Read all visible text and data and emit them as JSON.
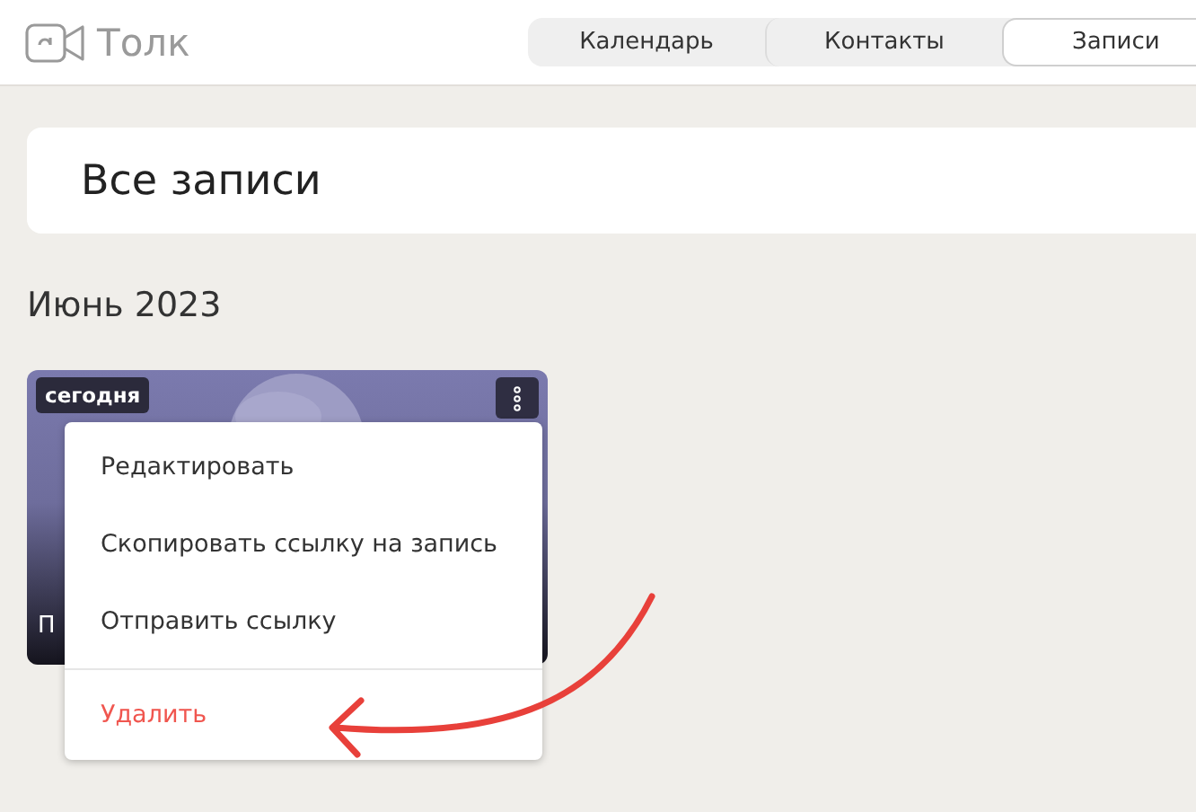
{
  "app": {
    "name": "Толк"
  },
  "tabs": [
    {
      "label": "Календарь",
      "selected": false
    },
    {
      "label": "Контакты",
      "selected": false
    },
    {
      "label": "Записи",
      "selected": true
    }
  ],
  "page_title": "Все записи",
  "month": "Июнь 2023",
  "recording": {
    "badge": "сегодня",
    "title": "П"
  },
  "menu": [
    {
      "label": "Редактировать",
      "kind": "normal"
    },
    {
      "label": "Скопировать ссылку на запись",
      "kind": "normal"
    },
    {
      "label": "Отправить ссылку",
      "kind": "normal"
    },
    {
      "label": "Удалить",
      "kind": "danger"
    }
  ]
}
